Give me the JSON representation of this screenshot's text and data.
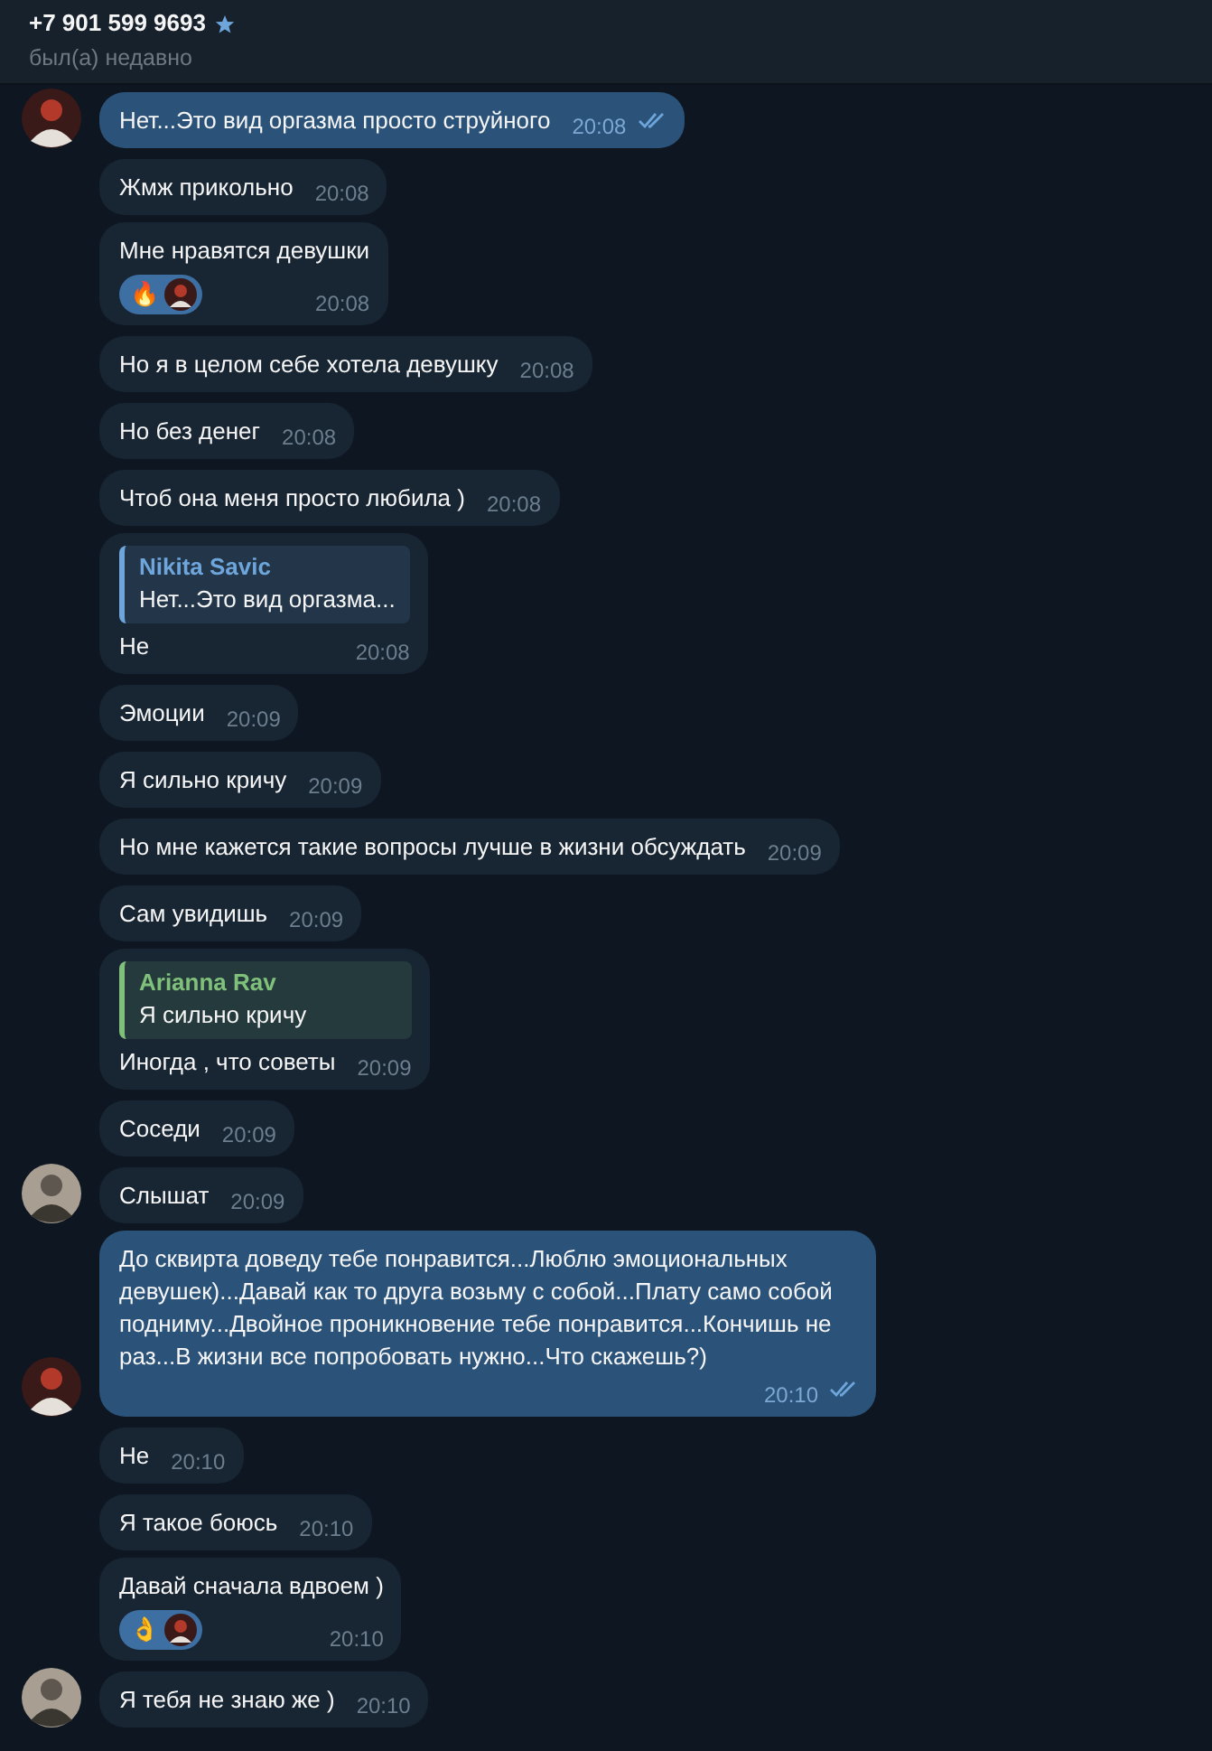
{
  "header": {
    "title": "+7 901 599 9693",
    "starred": true,
    "status": "был(а) недавно"
  },
  "messages": [
    {
      "kind": "out",
      "text": "Нет...Это вид оргазма просто струйного",
      "time": "20:08",
      "read": true,
      "avatar": true
    },
    {
      "kind": "in",
      "text": "Жмж прикольно",
      "time": "20:08",
      "avatar": false
    },
    {
      "kind": "in",
      "text": "Мне нравятся девушки",
      "time": "20:08",
      "avatar": false,
      "reactions": [
        {
          "emoji": "🔥"
        }
      ]
    },
    {
      "kind": "in",
      "text": "Но я в целом себе хотела девушку",
      "time": "20:08",
      "avatar": false
    },
    {
      "kind": "in",
      "text": "Но без денег",
      "time": "20:08",
      "avatar": false
    },
    {
      "kind": "in",
      "text": "Чтоб она меня просто любила )",
      "time": "20:08",
      "avatar": false
    },
    {
      "kind": "in",
      "text": "Не",
      "time": "20:08",
      "avatar": false,
      "reply": {
        "name": "Nikita Savic",
        "text": "Нет...Это вид оргазма...",
        "color": "#6ea6dc"
      }
    },
    {
      "kind": "in",
      "text": "Эмоции",
      "time": "20:09",
      "avatar": false
    },
    {
      "kind": "in",
      "text": "Я сильно кричу",
      "time": "20:09",
      "avatar": false
    },
    {
      "kind": "in",
      "text": "Но мне кажется такие вопросы лучше в жизни обсуждать",
      "time": "20:09",
      "avatar": false
    },
    {
      "kind": "in",
      "text": "Сам увидишь",
      "time": "20:09",
      "avatar": false
    },
    {
      "kind": "in",
      "text": "Иногда , что советы",
      "time": "20:09",
      "avatar": false,
      "reply": {
        "name": "Arianna Rav",
        "text": "Я сильно кричу",
        "color": "#7fc07a"
      }
    },
    {
      "kind": "in",
      "text": "Соседи",
      "time": "20:09",
      "avatar": false
    },
    {
      "kind": "in",
      "text": "Слышат",
      "time": "20:09",
      "avatar": true
    },
    {
      "kind": "out",
      "text": "До сквирта доведу тебе понравится...Люблю эмоциональных девушек)...Давай как то друга возьму с собой...Плату само собой подниму...Двойное проникновение тебе понравится...Кончишь не раз...В жизни все попробовать нужно...Что скажешь?)",
      "time": "20:10",
      "read": true,
      "avatar": true
    },
    {
      "kind": "in",
      "text": "Не",
      "time": "20:10",
      "avatar": false
    },
    {
      "kind": "in",
      "text": "Я такое боюсь",
      "time": "20:10",
      "avatar": false
    },
    {
      "kind": "in",
      "text": "Давай сначала вдвоем )",
      "time": "20:10",
      "avatar": false,
      "reactions": [
        {
          "emoji": "👌"
        }
      ]
    },
    {
      "kind": "in",
      "text": "Я тебя не знаю же )",
      "time": "20:10",
      "avatar": true
    }
  ]
}
